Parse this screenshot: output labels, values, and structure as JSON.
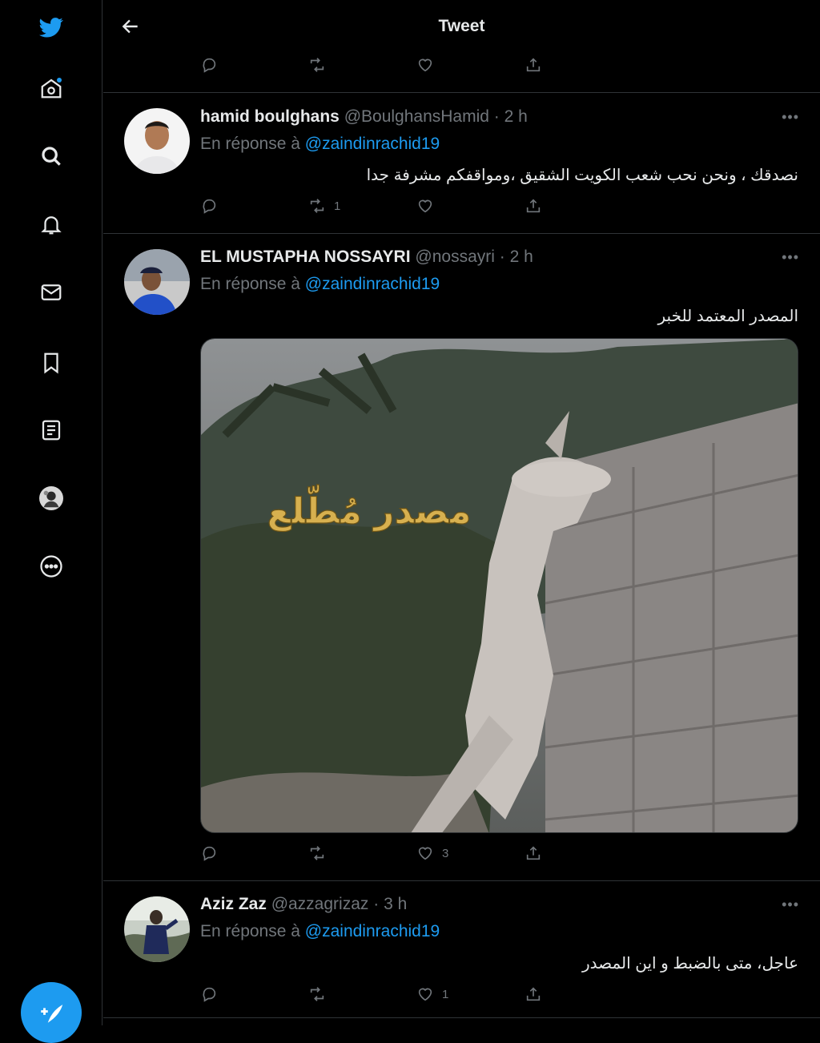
{
  "header": {
    "title": "Tweet"
  },
  "sidebar": {
    "items": [
      "twitter-logo",
      "home-icon",
      "explore-icon",
      "notifications-icon",
      "messages-icon",
      "bookmarks-icon",
      "lists-icon",
      "profile-avatar",
      "more-icon"
    ],
    "compose_icon": "compose-icon"
  },
  "reply_prefix": "En réponse à",
  "tweets": [
    {
      "name": "hamid boulghans",
      "handle": "@BoulghansHamid",
      "time": "2 h",
      "mention": "@zaindinrachid19",
      "text": "نصدقك ، ونحن نحب شعب الكويت الشقيق ،ومواقفكم مشرفة جدا",
      "retweets": "1",
      "likes": ""
    },
    {
      "name": "EL MUSTAPHA NOSSAYRI",
      "handle": "@nossayri",
      "time": "2 h",
      "mention": "@zaindinrachid19",
      "text": "المصدر المعتمد للخبر",
      "media_caption": "مصدر مُطّلع",
      "retweets": "",
      "likes": "3"
    },
    {
      "name": "Aziz Zaz",
      "handle": "@azzagrizaz",
      "time": "3 h",
      "mention": "@zaindinrachid19",
      "text": "عاجل، متى بالضبط و اين المصدر",
      "retweets": "",
      "likes": "1"
    }
  ],
  "colors": {
    "accent": "#1d9bf0",
    "background": "#000000",
    "muted": "#71767b",
    "divider": "#2f3336"
  }
}
